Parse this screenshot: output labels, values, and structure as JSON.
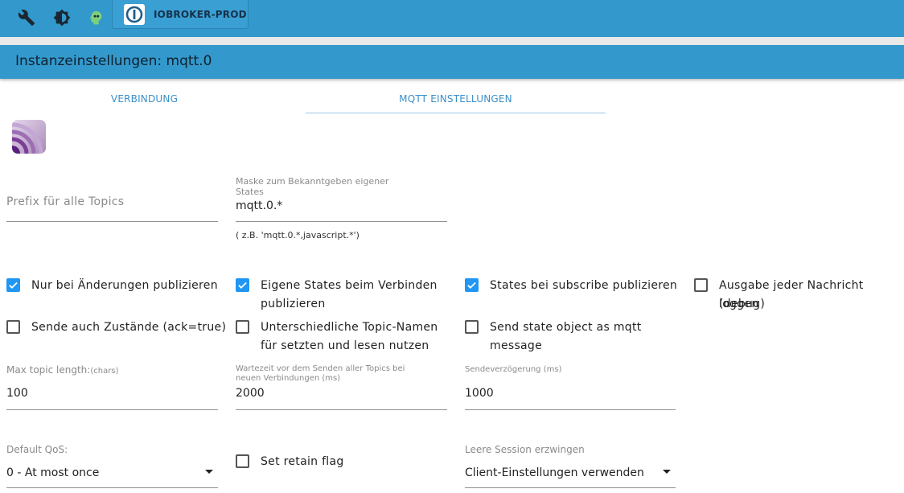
{
  "topbar": {
    "icons": [
      "wrench-icon",
      "brightness-icon",
      "head-icon"
    ],
    "host_label": "IOBROKER-PROD",
    "accent": "#3399cc"
  },
  "title": "Instanzeinstellungen: mqtt.0",
  "tabs": [
    {
      "label": "VERBINDUNG",
      "active": false
    },
    {
      "label": "MQTT EINSTELLUNGEN",
      "active": true
    }
  ],
  "fields": {
    "prefix": {
      "placeholder": "Prefix für alle Topics",
      "value": ""
    },
    "mask": {
      "label": "Maske zum Bekanntgeben eigener States",
      "value": "mqtt.0.*",
      "hint": "( z.B. 'mqtt.0.*,javascript.*')"
    },
    "max_topic_length": {
      "label": "Max topic length:",
      "label_suffix": "(chars)",
      "value": "100"
    },
    "wait_time": {
      "label": "Wartezeit vor dem Senden aller Topics bei neuen Verbindungen (ms)",
      "value": "2000"
    },
    "send_delay": {
      "label": "Sendeverzögerung (ms)",
      "value": "1000"
    },
    "default_qos": {
      "label": "Default QoS:",
      "value": "0 - At most once"
    },
    "clean_session": {
      "label": "Leere Session erzwingen",
      "value": "Client-Einstellungen verwenden"
    }
  },
  "checkboxes": {
    "only_changes": {
      "label": "Nur bei Änderungen publizieren",
      "checked": true
    },
    "own_states": {
      "line1": "Eigene States beim Verbinden",
      "line2": "publizieren",
      "checked": true
    },
    "states_subscribe": {
      "label": "States bei subscribe publizieren",
      "checked": true
    },
    "log_messages": {
      "line1": "Ausgabe jeder Nachricht loggen",
      "line2": "(debug)",
      "checked": false
    },
    "send_ack": {
      "label": "Sende auch Zustände (ack=true)",
      "checked": false
    },
    "different_topics": {
      "line1": "Unterschiedliche Topic-Namen",
      "line2": "für setzten und lesen nutzen",
      "checked": false
    },
    "state_object": {
      "line1": "Send state object as mqtt",
      "line2": "message",
      "checked": false
    },
    "retain": {
      "label": "Set retain flag",
      "checked": false
    }
  }
}
